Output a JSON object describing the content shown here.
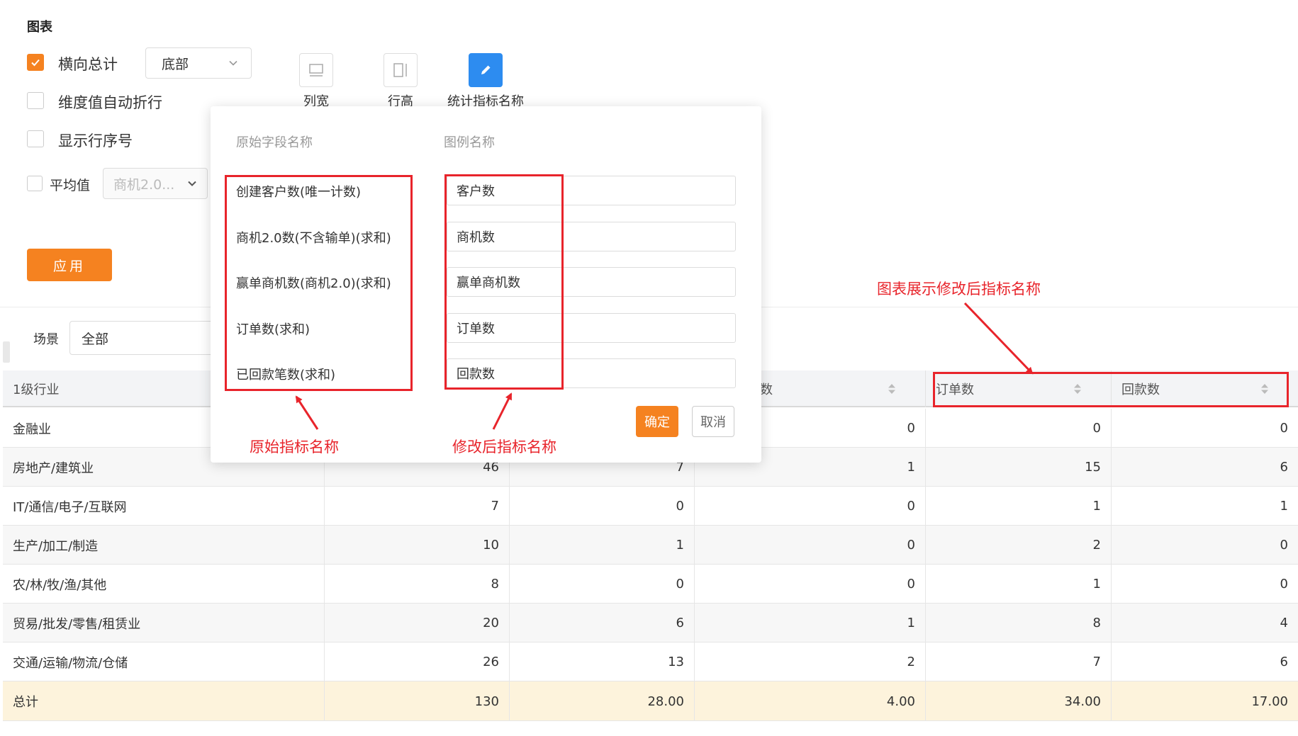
{
  "settings": {
    "section_title": "图表",
    "options": [
      {
        "label": "横向总计",
        "checked": true
      },
      {
        "label": "维度值自动折行",
        "checked": false
      },
      {
        "label": "显示行序号",
        "checked": false
      },
      {
        "label": "平均值",
        "checked": false
      }
    ],
    "total_position_select": "底部",
    "average_field_select": "商机2.0...",
    "tools": [
      {
        "label": "列宽",
        "icon": "column-width-icon"
      },
      {
        "label": "行高",
        "icon": "row-height-icon"
      },
      {
        "label": "统计指标名称",
        "icon": "pencil-icon"
      }
    ],
    "apply_label": "应用"
  },
  "filter": {
    "scene_label": "场景",
    "scene_value": "全部"
  },
  "dialog": {
    "col_original": "原始字段名称",
    "col_legend": "图例名称",
    "rows": [
      {
        "original": "创建客户数(唯一计数)",
        "legend": "客户数"
      },
      {
        "original": "商机2.0数(不含输单)(求和)",
        "legend": "商机数"
      },
      {
        "original": "赢单商机数(商机2.0)(求和)",
        "legend": "赢单商机数"
      },
      {
        "original": "订单数(求和)",
        "legend": "订单数"
      },
      {
        "original": "已回款笔数(求和)",
        "legend": "回款数"
      }
    ],
    "confirm_label": "确定",
    "cancel_label": "取消"
  },
  "annotations": {
    "original": "原始指标名称",
    "modified": "修改后指标名称",
    "chart_display": "图表展示修改后指标名称"
  },
  "table": {
    "headers": [
      "1级行业",
      "",
      "",
      "数",
      "订单数",
      "回款数"
    ],
    "rows": [
      {
        "industry": "金融业",
        "c1": "",
        "c2": "",
        "c3": "0",
        "c4": "0",
        "c5": "0"
      },
      {
        "industry": "房地产/建筑业",
        "c1": "46",
        "c2": "7",
        "c3": "1",
        "c4": "15",
        "c5": "6"
      },
      {
        "industry": "IT/通信/电子/互联网",
        "c1": "7",
        "c2": "0",
        "c3": "0",
        "c4": "1",
        "c5": "1"
      },
      {
        "industry": "生产/加工/制造",
        "c1": "10",
        "c2": "1",
        "c3": "0",
        "c4": "2",
        "c5": "0"
      },
      {
        "industry": "农/林/牧/渔/其他",
        "c1": "8",
        "c2": "0",
        "c3": "0",
        "c4": "1",
        "c5": "0"
      },
      {
        "industry": "贸易/批发/零售/租赁业",
        "c1": "20",
        "c2": "6",
        "c3": "1",
        "c4": "8",
        "c5": "4"
      },
      {
        "industry": "交通/运输/物流/仓储",
        "c1": "26",
        "c2": "13",
        "c3": "2",
        "c4": "7",
        "c5": "6"
      }
    ],
    "total": {
      "industry": "总计",
      "c1": "130",
      "c2": "28.00",
      "c3": "4.00",
      "c4": "34.00",
      "c5": "17.00"
    }
  },
  "colors": {
    "accent": "#f58220",
    "annotation_red": "#e8242b",
    "tool_active": "#2d8cf0",
    "total_row_bg": "#fdf3dc"
  }
}
